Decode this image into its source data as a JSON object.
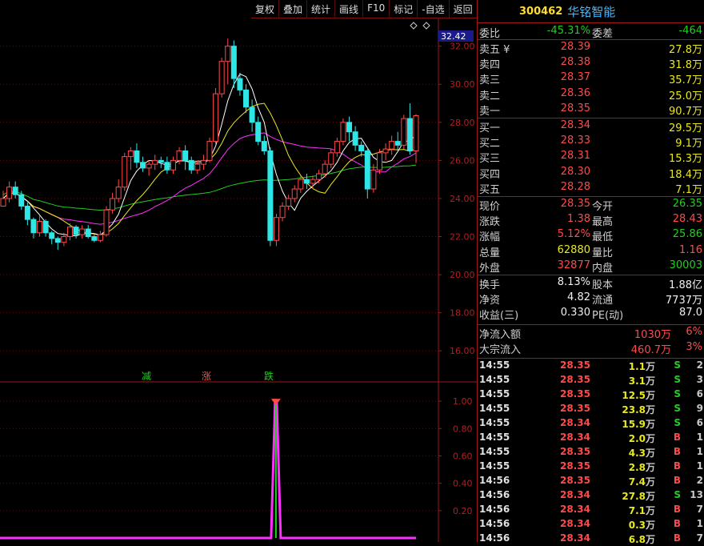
{
  "toolbar": [
    "复权",
    "叠加",
    "统计",
    "画线",
    "F10",
    "标记",
    "-自选",
    "返回"
  ],
  "stock": {
    "code": "300462",
    "name": "华铭智能"
  },
  "price_tag": "32.42",
  "signals": [
    {
      "text": "减",
      "color": "#1ed11e"
    },
    {
      "text": "涨",
      "color": "#ff4a4a"
    },
    {
      "text": "跌",
      "color": "#1ed11e"
    }
  ],
  "commission": {
    "ratio_label": "委比",
    "ratio": "-45.31%",
    "diff_label": "委差",
    "diff": "-464"
  },
  "sell": [
    {
      "label": "卖五",
      "mark": "¥",
      "price": "28.39",
      "vol": "27.8万"
    },
    {
      "label": "卖四",
      "mark": "",
      "price": "28.38",
      "vol": "31.8万"
    },
    {
      "label": "卖三",
      "mark": "",
      "price": "28.37",
      "vol": "35.7万"
    },
    {
      "label": "卖二",
      "mark": "",
      "price": "28.36",
      "vol": "25.0万"
    },
    {
      "label": "卖一",
      "mark": "",
      "price": "28.35",
      "vol": "90.7万"
    }
  ],
  "buy": [
    {
      "label": "买一",
      "price": "28.34",
      "vol": "29.5万"
    },
    {
      "label": "买二",
      "price": "28.33",
      "vol": "9.1万"
    },
    {
      "label": "买三",
      "price": "28.31",
      "vol": "15.3万"
    },
    {
      "label": "买四",
      "price": "28.30",
      "vol": "18.4万"
    },
    {
      "label": "买五",
      "price": "28.28",
      "vol": "7.1万"
    }
  ],
  "quote": [
    {
      "l1": "现价",
      "v1": "28.35",
      "c1": "red",
      "l2": "今开",
      "v2": "26.35",
      "c2": "green"
    },
    {
      "l1": "涨跌",
      "v1": "1.38",
      "c1": "red",
      "l2": "最高",
      "v2": "28.43",
      "c2": "red"
    },
    {
      "l1": "涨幅",
      "v1": "5.12%",
      "c1": "red",
      "l2": "最低",
      "v2": "25.86",
      "c2": "green"
    },
    {
      "l1": "总量",
      "v1": "62880",
      "c1": "yellow",
      "l2": "量比",
      "v2": "1.16",
      "c2": "red"
    },
    {
      "l1": "外盘",
      "v1": "32877",
      "c1": "red",
      "l2": "内盘",
      "v2": "30003",
      "c2": "green"
    }
  ],
  "fundamentals": [
    {
      "l1": "换手",
      "v1": "8.13%",
      "l2": "股本",
      "v2": "1.88亿"
    },
    {
      "l1": "净资",
      "v1": "4.82",
      "l2": "流通",
      "v2": "7737万"
    },
    {
      "l1": "收益(三)",
      "v1": "0.330",
      "l2": "PE(动)",
      "v2": "87.0"
    }
  ],
  "flow": [
    {
      "label": "净流入额",
      "value": "1030万",
      "pct": "6%"
    },
    {
      "label": "大宗流入",
      "value": "460.7万",
      "pct": "3%"
    }
  ],
  "ticks": [
    {
      "time": "14:55",
      "price": "28.35",
      "vol": "1.1",
      "dir": "S",
      "cnt": "2"
    },
    {
      "time": "14:55",
      "price": "28.35",
      "vol": "3.1",
      "dir": "S",
      "cnt": "3"
    },
    {
      "time": "14:55",
      "price": "28.35",
      "vol": "12.5",
      "dir": "S",
      "cnt": "6"
    },
    {
      "time": "14:55",
      "price": "28.35",
      "vol": "23.8",
      "dir": "S",
      "cnt": "9"
    },
    {
      "time": "14:55",
      "price": "28.34",
      "vol": "15.9",
      "dir": "S",
      "cnt": "6"
    },
    {
      "time": "14:55",
      "price": "28.34",
      "vol": "2.0",
      "dir": "B",
      "cnt": "1"
    },
    {
      "time": "14:55",
      "price": "28.35",
      "vol": "4.3",
      "dir": "B",
      "cnt": "1"
    },
    {
      "time": "14:55",
      "price": "28.35",
      "vol": "2.8",
      "dir": "B",
      "cnt": "1"
    },
    {
      "time": "14:56",
      "price": "28.35",
      "vol": "7.4",
      "dir": "B",
      "cnt": "2"
    },
    {
      "time": "14:56",
      "price": "28.34",
      "vol": "27.8",
      "dir": "S",
      "cnt": "13"
    },
    {
      "time": "14:56",
      "price": "28.34",
      "vol": "7.1",
      "dir": "B",
      "cnt": "7"
    },
    {
      "time": "14:56",
      "price": "28.34",
      "vol": "0.3",
      "dir": "B",
      "cnt": "1"
    },
    {
      "time": "14:56",
      "price": "28.34",
      "vol": "6.8",
      "dir": "B",
      "cnt": "7"
    }
  ],
  "tick_unit": "万",
  "chart_data": [
    {
      "type": "candlestick",
      "ylim": [
        15,
        33.5
      ],
      "y_ticks": [
        "32.00",
        "30.00",
        "28.00",
        "26.00",
        "24.00",
        "22.00",
        "20.00",
        "18.00",
        "16.00"
      ],
      "y_tick_values": [
        32,
        30,
        28,
        26,
        24,
        22,
        20,
        18,
        16
      ],
      "colors": {
        "up": "#ff4a4a",
        "down": "#2ee6e6",
        "ma5": "#ffffff",
        "ma10": "#e8e81e",
        "ma20": "#ff30ff",
        "ma60": "#22cc22"
      },
      "candles": [
        [
          23.6,
          24.0,
          23.6,
          24.4
        ],
        [
          24.0,
          24.6,
          23.8,
          24.9
        ],
        [
          24.6,
          24.2,
          24.0,
          24.9
        ],
        [
          24.2,
          23.6,
          23.4,
          24.4
        ],
        [
          23.6,
          22.9,
          22.6,
          23.8
        ],
        [
          22.9,
          22.2,
          21.9,
          23.0
        ],
        [
          22.2,
          22.8,
          22.0,
          23.1
        ],
        [
          22.8,
          22.2,
          22.0,
          22.9
        ],
        [
          22.2,
          21.9,
          21.6,
          22.3
        ],
        [
          21.9,
          21.7,
          21.3,
          22.0
        ],
        [
          21.7,
          22.0,
          21.5,
          22.2
        ],
        [
          22.0,
          22.5,
          21.8,
          22.7
        ],
        [
          22.5,
          22.1,
          21.9,
          22.6
        ],
        [
          22.1,
          22.4,
          21.9,
          22.6
        ],
        [
          22.4,
          22.0,
          21.9,
          22.6
        ],
        [
          22.0,
          21.8,
          21.7,
          22.1
        ],
        [
          21.8,
          22.1,
          21.7,
          22.3
        ],
        [
          22.1,
          23.4,
          22.0,
          23.6
        ],
        [
          23.4,
          24.0,
          23.2,
          24.3
        ],
        [
          24.0,
          24.6,
          23.8,
          25.0
        ],
        [
          24.6,
          26.2,
          24.4,
          26.4
        ],
        [
          26.2,
          26.5,
          25.5,
          26.7
        ],
        [
          26.5,
          25.9,
          25.6,
          26.9
        ],
        [
          25.9,
          25.6,
          25.4,
          26.2
        ],
        [
          25.6,
          25.8,
          25.2,
          26.0
        ],
        [
          25.8,
          26.0,
          25.5,
          26.3
        ],
        [
          26.0,
          25.9,
          25.6,
          26.2
        ],
        [
          25.9,
          25.5,
          25.3,
          26.2
        ],
        [
          25.5,
          26.0,
          25.3,
          26.2
        ],
        [
          26.0,
          26.5,
          25.8,
          26.7
        ],
        [
          26.5,
          26.0,
          25.5,
          26.8
        ],
        [
          26.0,
          25.5,
          25.3,
          26.2
        ],
        [
          25.5,
          25.8,
          25.3,
          26.0
        ],
        [
          25.8,
          26.0,
          25.5,
          26.3
        ],
        [
          26.0,
          27.0,
          25.9,
          27.2
        ],
        [
          27.0,
          29.5,
          26.8,
          29.8
        ],
        [
          29.5,
          31.2,
          29.3,
          31.4
        ],
        [
          31.2,
          32.0,
          30.0,
          32.4
        ],
        [
          32.0,
          30.3,
          29.8,
          32.3
        ],
        [
          30.3,
          29.7,
          29.4,
          30.6
        ],
        [
          29.7,
          28.8,
          28.5,
          30.0
        ],
        [
          28.8,
          28.0,
          27.5,
          29.2
        ],
        [
          28.0,
          27.0,
          26.8,
          28.3
        ],
        [
          27.0,
          26.5,
          26.3,
          27.3
        ],
        [
          26.5,
          21.8,
          21.5,
          26.7
        ],
        [
          21.8,
          23.0,
          21.5,
          23.2
        ],
        [
          23.0,
          23.6,
          22.8,
          23.8
        ],
        [
          23.6,
          24.0,
          23.4,
          24.2
        ],
        [
          24.0,
          24.5,
          23.8,
          24.7
        ],
        [
          24.5,
          25.0,
          24.3,
          25.2
        ],
        [
          25.0,
          24.8,
          24.5,
          25.3
        ],
        [
          24.8,
          25.0,
          24.5,
          25.2
        ],
        [
          25.0,
          25.3,
          24.8,
          25.5
        ],
        [
          25.3,
          25.8,
          25.1,
          26.0
        ],
        [
          25.8,
          26.4,
          25.6,
          26.6
        ],
        [
          26.4,
          27.0,
          26.2,
          27.2
        ],
        [
          27.0,
          28.0,
          26.8,
          28.2
        ],
        [
          28.0,
          27.5,
          27.0,
          28.3
        ],
        [
          27.5,
          26.8,
          26.5,
          27.8
        ],
        [
          26.8,
          26.5,
          26.2,
          27.0
        ],
        [
          26.5,
          24.5,
          24.0,
          26.6
        ],
        [
          24.5,
          25.5,
          24.3,
          25.8
        ],
        [
          25.5,
          26.4,
          25.3,
          26.6
        ],
        [
          26.4,
          26.6,
          26.0,
          26.9
        ],
        [
          26.6,
          27.0,
          26.3,
          27.3
        ],
        [
          27.0,
          26.8,
          26.5,
          27.5
        ],
        [
          26.8,
          28.2,
          26.6,
          28.4
        ],
        [
          28.2,
          26.5,
          26.3,
          29.0
        ],
        [
          26.5,
          28.35,
          25.86,
          28.43
        ]
      ]
    },
    {
      "type": "line",
      "ylim": [
        0,
        1.1
      ],
      "y_ticks": [
        "1.00",
        "0.80",
        "0.60",
        "0.40",
        "0.20"
      ],
      "y_tick_values": [
        1.0,
        0.8,
        0.6,
        0.4,
        0.2
      ],
      "series": [
        {
          "values_index_spike": {
            "index": 44,
            "value": 1.0
          }
        }
      ]
    }
  ]
}
